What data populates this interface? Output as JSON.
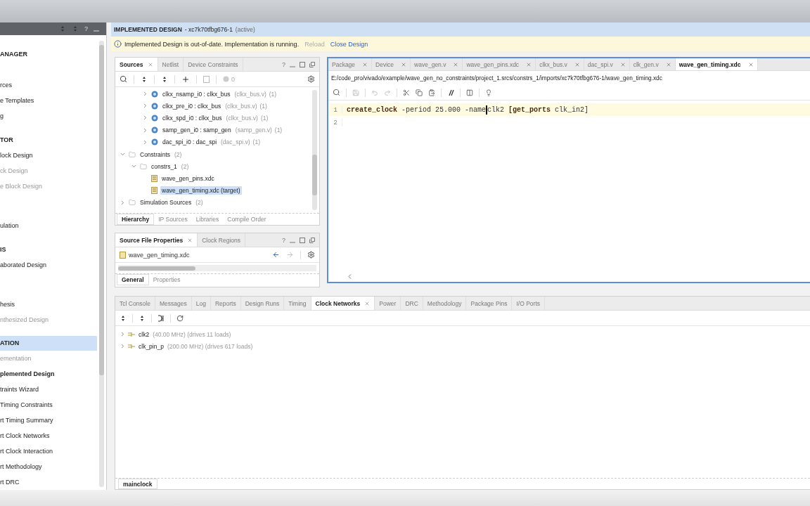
{
  "flow_navigator": {
    "help": "?",
    "items": [
      {
        "kind": "heading",
        "label": "ANAGER",
        "selected": false,
        "disabled": false
      },
      {
        "kind": "gap"
      },
      {
        "kind": "item",
        "label": "rces",
        "selected": false,
        "disabled": false,
        "bold": false
      },
      {
        "kind": "item",
        "label": "e Templates",
        "selected": false,
        "disabled": false,
        "bold": false
      },
      {
        "kind": "item",
        "label": "g",
        "selected": false,
        "disabled": false,
        "bold": false
      },
      {
        "kind": "heading",
        "label": "TOR",
        "selected": false,
        "disabled": false
      },
      {
        "kind": "item",
        "label": "lock Design",
        "selected": false,
        "disabled": false,
        "bold": false
      },
      {
        "kind": "item",
        "label": "ck Design",
        "selected": false,
        "disabled": true,
        "bold": false
      },
      {
        "kind": "item",
        "label": "e Block Design",
        "selected": false,
        "disabled": true,
        "bold": false
      },
      {
        "kind": "heading_gap"
      },
      {
        "kind": "item",
        "label": "ulation",
        "selected": false,
        "disabled": false,
        "bold": false
      },
      {
        "kind": "heading",
        "label": "IS",
        "selected": false,
        "disabled": false
      },
      {
        "kind": "item",
        "label": "aborated Design",
        "selected": false,
        "disabled": false,
        "bold": false
      },
      {
        "kind": "heading_gap"
      },
      {
        "kind": "item",
        "label": "hesis",
        "selected": false,
        "disabled": false,
        "bold": false
      },
      {
        "kind": "item",
        "label": "nthesized Design",
        "selected": false,
        "disabled": true,
        "bold": false
      },
      {
        "kind": "heading",
        "label": "ATION",
        "selected": true,
        "disabled": false
      },
      {
        "kind": "item",
        "label": "ementation",
        "selected": false,
        "disabled": true,
        "bold": false
      },
      {
        "kind": "item",
        "label": "plemented Design",
        "selected": false,
        "disabled": false,
        "bold": true
      },
      {
        "kind": "item",
        "label": "traints Wizard",
        "selected": false,
        "disabled": false,
        "bold": false
      },
      {
        "kind": "item",
        "label": "Timing Constraints",
        "selected": false,
        "disabled": false,
        "bold": false
      },
      {
        "kind": "item",
        "label": "rt Timing Summary",
        "selected": false,
        "disabled": false,
        "bold": false
      },
      {
        "kind": "item",
        "label": "rt Clock Networks",
        "selected": false,
        "disabled": false,
        "bold": false
      },
      {
        "kind": "item",
        "label": "rt Clock Interaction",
        "selected": false,
        "disabled": false,
        "bold": false
      },
      {
        "kind": "item",
        "label": "rt Methodology",
        "selected": false,
        "disabled": false,
        "bold": false
      },
      {
        "kind": "item",
        "label": "rt DRC",
        "selected": false,
        "disabled": false,
        "bold": false
      }
    ]
  },
  "design_header": {
    "title": "IMPLEMENTED DESIGN",
    "part": " - xc7k70tfbg676-1",
    "status": "(active)"
  },
  "banner": {
    "message": "Implemented Design is out-of-date. Implementation is running.",
    "links": [
      {
        "label": "Reload",
        "disabled": true
      },
      {
        "label": "Close Design",
        "disabled": false
      }
    ]
  },
  "sources_panel": {
    "help": "?",
    "tabs": [
      {
        "label": "Sources",
        "selected": true
      },
      {
        "label": "Netlist",
        "selected": false
      },
      {
        "label": "Device Constraints",
        "selected": false
      }
    ],
    "message_count": "0",
    "tree": [
      {
        "kind": "scrolled_out",
        "children": [
          {
            "kind": "scrolled_out",
            "children": [
              {
                "kind": "instance",
                "name": "clkx_nsamp_i0 : clkx_bus",
                "file": "(clkx_bus.v)",
                "count": "(1)",
                "expanded": false,
                "selected": false
              },
              {
                "kind": "instance",
                "name": "clkx_pre_i0 : clkx_bus",
                "file": "(clkx_bus.v)",
                "count": "(1)",
                "expanded": false,
                "selected": false
              },
              {
                "kind": "instance",
                "name": "clkx_spd_i0 : clkx_bus",
                "file": "(clkx_bus.v)",
                "count": "(1)",
                "expanded": false,
                "selected": false
              },
              {
                "kind": "instance",
                "name": "samp_gen_i0 : samp_gen",
                "file": "(samp_gen.v)",
                "count": "(1)",
                "expanded": false,
                "selected": false
              },
              {
                "kind": "instance",
                "name": "dac_spi_i0 : dac_spi",
                "file": "(dac_spi.v)",
                "count": "(1)",
                "expanded": false,
                "selected": false
              }
            ]
          }
        ]
      },
      {
        "kind": "folder",
        "name": "Constraints",
        "count": "(2)",
        "expanded": true,
        "selected": false,
        "children": [
          {
            "kind": "folder",
            "name": "constrs_1",
            "count": "(2)",
            "expanded": true,
            "selected": false,
            "children": [
              {
                "kind": "file",
                "name": "wave_gen_pins.xdc",
                "selected": false
              },
              {
                "kind": "file",
                "name": "wave_gen_timing.xdc (target)",
                "selected": true
              }
            ]
          }
        ]
      },
      {
        "kind": "folder",
        "name": "Simulation Sources",
        "count": "(2)",
        "expanded": false,
        "selected": false
      }
    ],
    "bottom_tabs": [
      {
        "label": "Hierarchy",
        "selected": true
      },
      {
        "label": "IP Sources",
        "selected": false
      },
      {
        "label": "Libraries",
        "selected": false
      },
      {
        "label": "Compile Order",
        "selected": false
      }
    ]
  },
  "properties_panel": {
    "help": "?",
    "tabs": [
      {
        "label": "Source File Properties",
        "selected": true
      },
      {
        "label": "Clock Regions",
        "selected": false
      }
    ],
    "file": "wave_gen_timing.xdc",
    "bottom_tabs": [
      {
        "label": "General",
        "selected": true
      },
      {
        "label": "Properties",
        "selected": false
      }
    ]
  },
  "editor": {
    "tabs": [
      {
        "label": "Package",
        "selected": false
      },
      {
        "label": "Device",
        "selected": false
      },
      {
        "label": "wave_gen.v",
        "selected": false
      },
      {
        "label": "wave_gen_pins.xdc",
        "selected": false
      },
      {
        "label": "clkx_bus.v",
        "selected": false
      },
      {
        "label": "dac_spi.v",
        "selected": false
      },
      {
        "label": "clk_gen.v",
        "selected": false
      },
      {
        "label": "wave_gen_timing.xdc",
        "selected": true
      }
    ],
    "path": "E:/code_pro/vivado/example/wave_gen_no_constraints/project_1.srcs/constrs_1/imports/xc7k70tfbg676-1/wave_gen_timing.xdc",
    "lines": [
      {
        "number": "1",
        "current": true,
        "tokens": [
          {
            "kind": "keyword",
            "text": "create_clock"
          },
          {
            "kind": "plain",
            "text": " -period 25.000 -name"
          },
          {
            "kind": "cursor"
          },
          {
            "kind": "plain",
            "text": "clk2 "
          },
          {
            "kind": "keyword",
            "text": "[get_ports"
          },
          {
            "kind": "plain",
            "text": " clk_in2]"
          }
        ]
      },
      {
        "number": "2",
        "current": false
      }
    ]
  },
  "bottom_panel": {
    "tabs": [
      {
        "label": "Tcl Console",
        "selected": false
      },
      {
        "label": "Messages",
        "selected": false
      },
      {
        "label": "Log",
        "selected": false
      },
      {
        "label": "Reports",
        "selected": false
      },
      {
        "label": "Design Runs",
        "selected": false
      },
      {
        "label": "Timing",
        "selected": false
      },
      {
        "label": "Clock Networks",
        "selected": true
      },
      {
        "label": "Power",
        "selected": false
      },
      {
        "label": "DRC",
        "selected": false
      },
      {
        "label": "Methodology",
        "selected": false
      },
      {
        "label": "Package Pins",
        "selected": false
      },
      {
        "label": "I/O Ports",
        "selected": false
      }
    ],
    "clocks": [
      {
        "name": "clk2",
        "detail": "(40.00 MHz) (drives 11 loads)",
        "expanded": false
      },
      {
        "name": "clk_pin_p",
        "detail": "(200.00 MHz) (drives 617 loads)",
        "expanded": false
      }
    ],
    "result_tabs": [
      {
        "label": "mainclock",
        "selected": true
      }
    ]
  }
}
